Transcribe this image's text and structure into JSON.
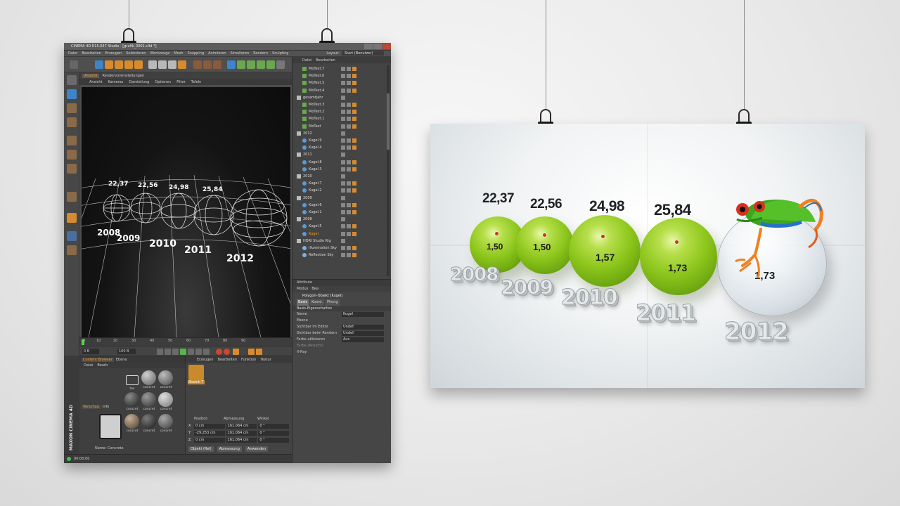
{
  "c4d": {
    "window_title": "CINEMA 4D R15.037 Studio - [grafik_0001.c4d *]",
    "menu": [
      "Datei",
      "Bearbeiten",
      "Erzeugen",
      "Selektieren",
      "Werkzeuge",
      "Mesh",
      "Snapping",
      "Animieren",
      "Simulieren",
      "Rendern",
      "Sculpting"
    ],
    "layout_label": "Layout:",
    "layout_value": "Start (Benutzer)",
    "viewport_tabs": [
      "Ansicht",
      "Rendervoreinstellungen"
    ],
    "viewport_menu": [
      "Ansicht",
      "Kameras",
      "Darstellung",
      "Optionen",
      "Filter",
      "Tafeln"
    ],
    "viewport_values": [
      "22,37",
      "22,56",
      "24,98",
      "25,84"
    ],
    "viewport_years": [
      "2008",
      "2009",
      "2010",
      "2011",
      "2012"
    ],
    "timeline_ticks": [
      "0",
      "10",
      "20",
      "30",
      "40",
      "50",
      "60",
      "70",
      "80",
      "90"
    ],
    "transport": {
      "start": "0 B",
      "end": "100 B",
      "current": "0 B"
    },
    "content_browser_tabs": [
      "Content Browser",
      "Ebene"
    ],
    "content_browser_menu": [
      "Datei",
      "Bearb"
    ],
    "materials": [
      "tex",
      "concret",
      "concret",
      "concret",
      "concret",
      "concret",
      "concret",
      "concret",
      "concret"
    ],
    "preview_tabs": [
      "Vorschau",
      "Info"
    ],
    "cb_name": "Name: Concrete",
    "brand": "MAXON CINEMA 4D",
    "ac_menu": [
      "Erzeugen",
      "Bearbeiten",
      "Funktion",
      "Textur"
    ],
    "sketch_label": "Sketch T",
    "coord_headers": [
      "Position",
      "Abmessung",
      "Winkel"
    ],
    "coord_rows": [
      {
        "axis": "X",
        "pos": "0 cm",
        "size": "161.064 cm",
        "angle": "0 °"
      },
      {
        "axis": "Y",
        "pos": "-29.253 cm",
        "size": "161.064 cm",
        "angle": "0 °"
      },
      {
        "axis": "Z",
        "pos": "0 cm",
        "size": "161.064 cm",
        "angle": "0 °"
      }
    ],
    "coord_buttons": [
      "Objekt (Rel)",
      "Abmessung",
      "Anwenden"
    ],
    "status_time": "00:00:00",
    "object_menu": [
      "Datei",
      "Bearbeiten"
    ],
    "objects": [
      {
        "name": "MoText.7",
        "indent": 1,
        "type": "text"
      },
      {
        "name": "MoText.6",
        "indent": 1,
        "type": "text"
      },
      {
        "name": "MoText.5",
        "indent": 1,
        "type": "text"
      },
      {
        "name": "MoText.4",
        "indent": 1,
        "type": "text"
      },
      {
        "name": "gesamtjahr",
        "indent": 0,
        "type": "null"
      },
      {
        "name": "MoText.3",
        "indent": 1,
        "type": "text"
      },
      {
        "name": "MoText.2",
        "indent": 1,
        "type": "text"
      },
      {
        "name": "MoText.1",
        "indent": 1,
        "type": "text"
      },
      {
        "name": "MoText",
        "indent": 1,
        "type": "text"
      },
      {
        "name": "2012",
        "indent": 0,
        "type": "null"
      },
      {
        "name": "Kugel.9",
        "indent": 1,
        "type": "sphere"
      },
      {
        "name": "Kugel.4",
        "indent": 1,
        "type": "sphere"
      },
      {
        "name": "2011",
        "indent": 0,
        "type": "null"
      },
      {
        "name": "Kugel.8",
        "indent": 1,
        "type": "sphere"
      },
      {
        "name": "Kugel.3",
        "indent": 1,
        "type": "sphere"
      },
      {
        "name": "2010",
        "indent": 0,
        "type": "null"
      },
      {
        "name": "Kugel.7",
        "indent": 1,
        "type": "sphere"
      },
      {
        "name": "Kugel.2",
        "indent": 1,
        "type": "sphere"
      },
      {
        "name": "2009",
        "indent": 0,
        "type": "null"
      },
      {
        "name": "Kugel.6",
        "indent": 1,
        "type": "sphere"
      },
      {
        "name": "Kugel.1",
        "indent": 1,
        "type": "sphere"
      },
      {
        "name": "2008",
        "indent": 0,
        "type": "null"
      },
      {
        "name": "Kugel.5",
        "indent": 1,
        "type": "sphere"
      },
      {
        "name": "Kugel",
        "indent": 1,
        "type": "sphere",
        "selected": true
      },
      {
        "name": "HDRI Studio Rig",
        "indent": 0,
        "type": "null"
      },
      {
        "name": "Illumination Sky",
        "indent": 1,
        "type": "sky"
      },
      {
        "name": "Reflection Sky",
        "indent": 1,
        "type": "sky"
      }
    ],
    "attr_header": "Attribute",
    "attr_menu": [
      "Modus",
      "Bea"
    ],
    "attr_object": "Polygon-Objekt [Kugel]",
    "attr_tabs": [
      "Basis",
      "Koord.",
      "Phong"
    ],
    "attr_section": "Basis-Eigenschaften",
    "attr_rows": [
      {
        "label": "Name",
        "value": "Kugel",
        "dim": false
      },
      {
        "label": "Ebene",
        "value": "",
        "dim": false
      },
      {
        "label": "Sichtbar im Editor",
        "value": "Undef.",
        "dim": false
      },
      {
        "label": "Sichtbar beim Rendern",
        "value": "Undef.",
        "dim": false
      },
      {
        "label": "Farbe aktivieren",
        "value": "Aus",
        "dim": false
      },
      {
        "label": "Farbe (Ansicht)",
        "value": "",
        "dim": true
      },
      {
        "label": "X-Ray",
        "value": "",
        "dim": false
      }
    ]
  },
  "render": {
    "values": [
      "22,37",
      "22,56",
      "24,98",
      "25,84"
    ],
    "ball_values": [
      "1,50",
      "1,50",
      "1,57",
      "1,73",
      "1,73"
    ],
    "years": [
      "2008",
      "2009",
      "2010",
      "2011",
      "2012"
    ]
  },
  "colors": {
    "accent": "#f0a030",
    "ball_green": "#8dc61c",
    "value_dot": "#c23a25"
  }
}
